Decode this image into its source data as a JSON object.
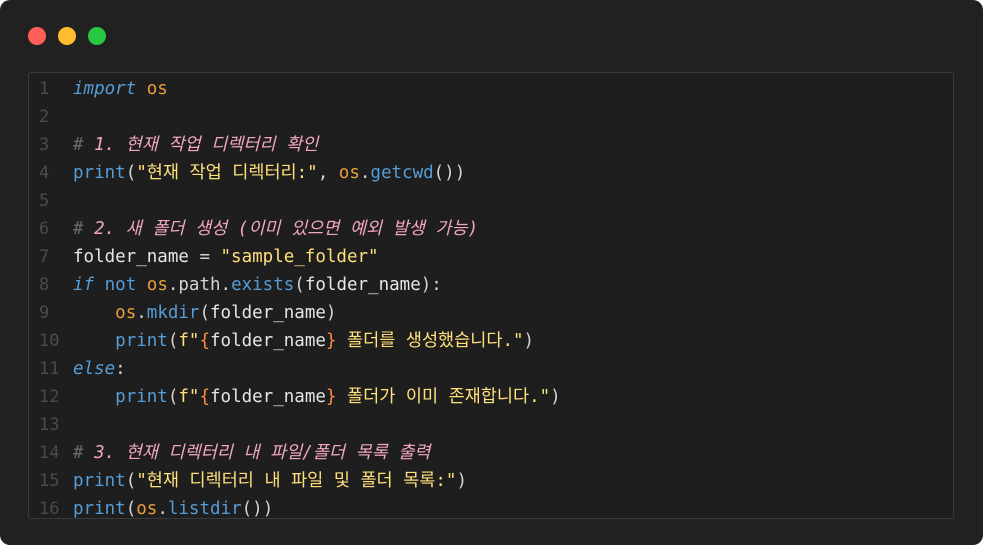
{
  "window": {
    "controls": [
      "close",
      "minimize",
      "maximize"
    ]
  },
  "editor": {
    "lines": [
      {
        "n": "1",
        "tokens": [
          [
            "kw",
            "import"
          ],
          [
            "punc",
            " "
          ],
          [
            "mod",
            "os"
          ]
        ]
      },
      {
        "n": "2",
        "tokens": []
      },
      {
        "n": "3",
        "tokens": [
          [
            "cmhash",
            "# "
          ],
          [
            "cm",
            "1. 현재 작업 디렉터리 확인"
          ]
        ]
      },
      {
        "n": "4",
        "tokens": [
          [
            "fn2",
            "print"
          ],
          [
            "punc",
            "("
          ],
          [
            "str",
            "\"현재 작업 디렉터리:\""
          ],
          [
            "punc",
            ", "
          ],
          [
            "mod",
            "os"
          ],
          [
            "punc",
            "."
          ],
          [
            "fn2",
            "getcwd"
          ],
          [
            "punc",
            "())"
          ]
        ]
      },
      {
        "n": "5",
        "tokens": []
      },
      {
        "n": "6",
        "tokens": [
          [
            "cmhash",
            "# "
          ],
          [
            "cm",
            "2. 새 폴더 생성 (이미 있으면 예외 발생 가능)"
          ]
        ]
      },
      {
        "n": "7",
        "tokens": [
          [
            "var",
            "folder_name"
          ],
          [
            "punc",
            " = "
          ],
          [
            "str",
            "\"sample_folder\""
          ]
        ]
      },
      {
        "n": "8",
        "tokens": [
          [
            "kw",
            "if"
          ],
          [
            "punc",
            " "
          ],
          [
            "kw2",
            "not"
          ],
          [
            "punc",
            " "
          ],
          [
            "mod",
            "os"
          ],
          [
            "punc",
            ".path."
          ],
          [
            "fn2",
            "exists"
          ],
          [
            "punc",
            "("
          ],
          [
            "var",
            "folder_name"
          ],
          [
            "punc",
            "):"
          ]
        ]
      },
      {
        "n": "9",
        "tokens": [
          [
            "punc",
            "    "
          ],
          [
            "mod",
            "os"
          ],
          [
            "punc",
            "."
          ],
          [
            "fn2",
            "mkdir"
          ],
          [
            "punc",
            "("
          ],
          [
            "var",
            "folder_name"
          ],
          [
            "punc",
            ")"
          ]
        ]
      },
      {
        "n": "10",
        "tokens": [
          [
            "punc",
            "    "
          ],
          [
            "fn2",
            "print"
          ],
          [
            "punc",
            "("
          ],
          [
            "str",
            "f\""
          ],
          [
            "brace",
            "{"
          ],
          [
            "var",
            "folder_name"
          ],
          [
            "brace",
            "}"
          ],
          [
            "str",
            " 폴더를 생성했습니다.\""
          ],
          [
            "punc",
            ")"
          ]
        ]
      },
      {
        "n": "11",
        "tokens": [
          [
            "kw",
            "else"
          ],
          [
            "punc",
            ":"
          ]
        ]
      },
      {
        "n": "12",
        "tokens": [
          [
            "punc",
            "    "
          ],
          [
            "fn2",
            "print"
          ],
          [
            "punc",
            "("
          ],
          [
            "str",
            "f\""
          ],
          [
            "brace",
            "{"
          ],
          [
            "var",
            "folder_name"
          ],
          [
            "brace",
            "}"
          ],
          [
            "str",
            " 폴더가 이미 존재합니다.\""
          ],
          [
            "punc",
            ")"
          ]
        ]
      },
      {
        "n": "13",
        "tokens": []
      },
      {
        "n": "14",
        "tokens": [
          [
            "cmhash",
            "# "
          ],
          [
            "cm",
            "3. 현재 디렉터리 내 파일/폴더 목록 출력"
          ]
        ]
      },
      {
        "n": "15",
        "tokens": [
          [
            "fn2",
            "print"
          ],
          [
            "punc",
            "("
          ],
          [
            "str",
            "\"현재 디렉터리 내 파일 및 폴더 목록:\""
          ],
          [
            "punc",
            ")"
          ]
        ]
      },
      {
        "n": "16",
        "tokens": [
          [
            "fn2",
            "print"
          ],
          [
            "punc",
            "("
          ],
          [
            "mod",
            "os"
          ],
          [
            "punc",
            "."
          ],
          [
            "fn2",
            "listdir"
          ],
          [
            "punc",
            "())"
          ]
        ]
      }
    ]
  }
}
